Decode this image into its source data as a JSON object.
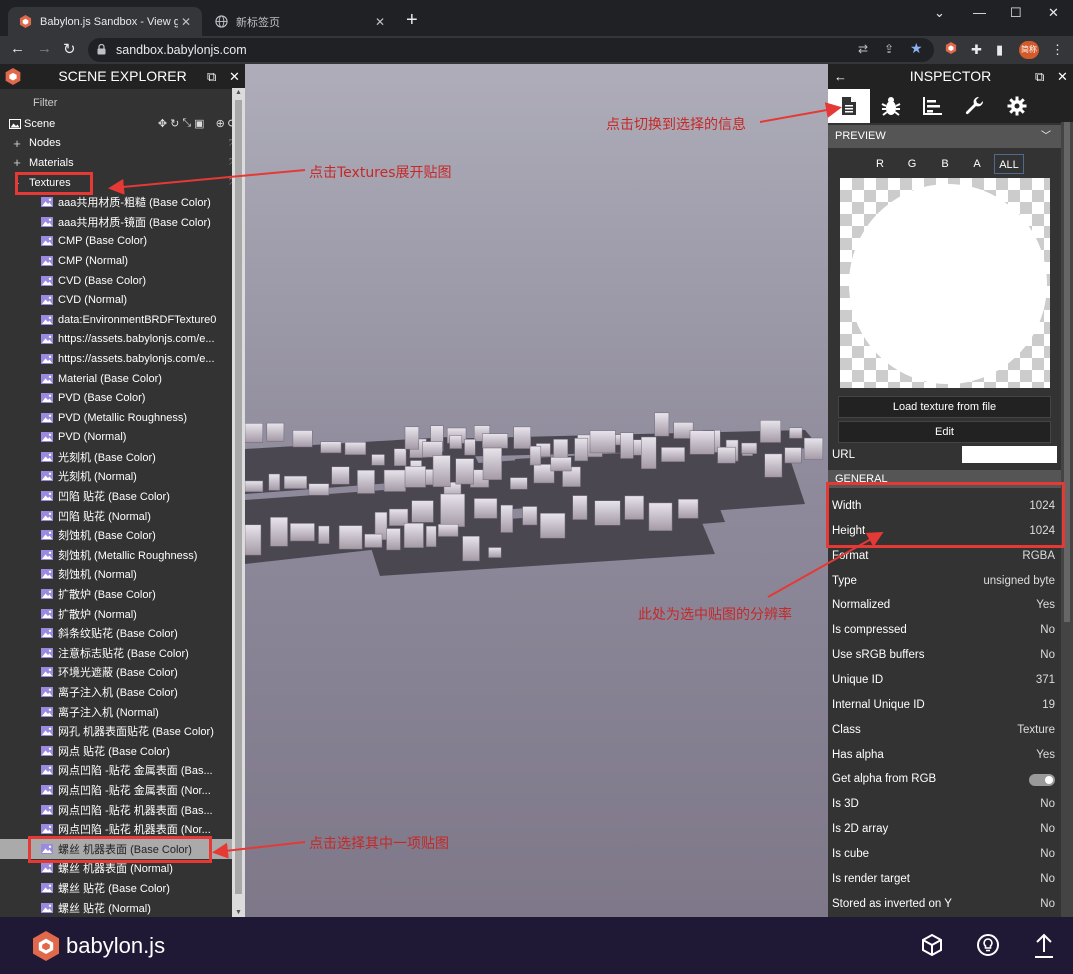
{
  "browser": {
    "tabs": [
      {
        "title": "Babylon.js Sandbox - View glTF",
        "active": true
      },
      {
        "title": "新标签页",
        "active": false
      }
    ],
    "url": "sandbox.babylonjs.com",
    "profile_label": "简称"
  },
  "explorer": {
    "title": "SCENE EXPLORER",
    "filter_label": "Filter",
    "scene_label": "Scene",
    "nodes_label": "Nodes",
    "materials_label": "Materials",
    "textures_label": "Textures",
    "textures": [
      "aaa共用材质-粗糙 (Base Color)",
      "aaa共用材质-镜面 (Base Color)",
      "CMP (Base Color)",
      "CMP (Normal)",
      "CVD (Base Color)",
      "CVD (Normal)",
      "data:EnvironmentBRDFTexture0",
      "https://assets.babylonjs.com/e...",
      "https://assets.babylonjs.com/e...",
      "Material (Base Color)",
      "PVD (Base Color)",
      "PVD (Metallic Roughness)",
      "PVD (Normal)",
      "光刻机 (Base Color)",
      "光刻机 (Normal)",
      "凹陷 贴花 (Base Color)",
      "凹陷 贴花 (Normal)",
      "刻蚀机 (Base Color)",
      "刻蚀机 (Metallic Roughness)",
      "刻蚀机 (Normal)",
      "扩散炉 (Base Color)",
      "扩散炉 (Normal)",
      "斜条纹贴花 (Base Color)",
      "注意标志贴花 (Base Color)",
      "环境光遮蔽 (Base Color)",
      "离子注入机 (Base Color)",
      "离子注入机 (Normal)",
      "网孔 机器表面贴花 (Base Color)",
      "网点 贴花 (Base Color)",
      "网点凹陷 -贴花 金属表面 (Bas...",
      "网点凹陷 -贴花 金属表面 (Nor...",
      "网点凹陷 -贴花 机器表面 (Bas...",
      "网点凹陷 -贴花 机器表面 (Nor...",
      "螺丝 机器表面 (Base Color)",
      "螺丝 机器表面 (Normal)",
      "螺丝 贴花 (Base Color)",
      "螺丝 贴花 (Normal)"
    ],
    "selected_index": 33
  },
  "inspector": {
    "title": "INSPECTOR",
    "preview_label": "PREVIEW",
    "channels": [
      "R",
      "G",
      "B",
      "A",
      "ALL"
    ],
    "active_channel": "ALL",
    "load_button": "Load texture from file",
    "edit_button": "Edit",
    "url_label": "URL",
    "general_label": "GENERAL",
    "properties": [
      {
        "label": "Width",
        "value": "1024"
      },
      {
        "label": "Height",
        "value": "1024"
      },
      {
        "label": "Format",
        "value": "RGBA"
      },
      {
        "label": "Type",
        "value": "unsigned byte"
      },
      {
        "label": "Normalized",
        "value": "Yes"
      },
      {
        "label": "Is compressed",
        "value": "No"
      },
      {
        "label": "Use sRGB buffers",
        "value": "No"
      },
      {
        "label": "Unique ID",
        "value": "371"
      },
      {
        "label": "Internal Unique ID",
        "value": "19"
      },
      {
        "label": "Class",
        "value": "Texture"
      },
      {
        "label": "Has alpha",
        "value": "Yes"
      },
      {
        "label": "Get alpha from RGB",
        "value": ""
      },
      {
        "label": "Is 3D",
        "value": "No"
      },
      {
        "label": "Is 2D array",
        "value": "No"
      },
      {
        "label": "Is cube",
        "value": "No"
      },
      {
        "label": "Is render target",
        "value": "No"
      },
      {
        "label": "Stored as inverted on Y",
        "value": "No"
      }
    ]
  },
  "footer": {
    "brand": "babylon.js"
  },
  "annotations": {
    "textures_hint": "点击Textures展开贴图",
    "inspector_hint": "点击切换到选择的信息",
    "resolution_hint": "此处为选中贴图的分辨率",
    "select_hint": "点击选择其中一项贴图"
  },
  "colors": {
    "annotation": "#e53935",
    "panel_bg": "#333333",
    "header_bg": "#222222",
    "footer_bg": "#201936",
    "accent": "#8ab4f8"
  }
}
